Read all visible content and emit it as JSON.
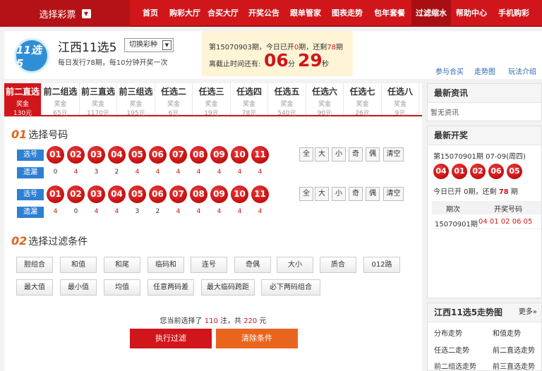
{
  "nav": {
    "select_label": "选择彩票",
    "items": [
      "首页",
      "购彩大厅",
      "合买大厅",
      "开奖公告",
      "跟单管家",
      "图表走势",
      "包年套餐",
      "过滤缩水",
      "帮助中心",
      "手机购彩"
    ],
    "active_index": 7
  },
  "lottery": {
    "logo_text": "11选5",
    "name": "江西11选5",
    "switch_label": "切换彩种",
    "subtitle": "每日发行78期，每10分钟开奖一次"
  },
  "period": {
    "prefix": "第",
    "issue": "15070903",
    "suffix1": "期，今日已开",
    "opened": "0",
    "suffix2": "期，还剩",
    "remain": "78",
    "suffix3": "期",
    "deadline_label": "离截止时间还有:",
    "minutes": "06",
    "min_unit": "分",
    "seconds": "29",
    "sec_unit": "秒"
  },
  "head_links": [
    "参与合买",
    "走势图",
    "玩法介绍"
  ],
  "tabs": [
    {
      "name": "前二直选",
      "label": "奖金",
      "prize": "130元"
    },
    {
      "name": "前二组选",
      "label": "奖金",
      "prize": "65元"
    },
    {
      "name": "前三直选",
      "label": "奖金",
      "prize": "1170元"
    },
    {
      "name": "前三组选",
      "label": "奖金",
      "prize": "195元"
    },
    {
      "name": "任选二",
      "label": "奖金",
      "prize": "6元"
    },
    {
      "name": "任选三",
      "label": "奖金",
      "prize": "19元"
    },
    {
      "name": "任选四",
      "label": "奖金",
      "prize": "78元"
    },
    {
      "name": "任选五",
      "label": "奖金",
      "prize": "540元"
    },
    {
      "name": "任选六",
      "label": "奖金",
      "prize": "90元"
    },
    {
      "name": "任选七",
      "label": "奖金",
      "prize": "26元"
    },
    {
      "name": "任选八",
      "label": "奖金",
      "prize": "9元"
    }
  ],
  "pick": {
    "num_label": "01",
    "title": "选择号码",
    "pick_label": "选号",
    "miss_label": "遗漏",
    "balls": [
      "01",
      "02",
      "03",
      "04",
      "05",
      "06",
      "07",
      "08",
      "09",
      "10",
      "11"
    ],
    "rows": [
      {
        "miss": [
          "0",
          "4",
          "3",
          "2",
          "4",
          "4",
          "4",
          "4",
          "4",
          "4",
          "4"
        ]
      },
      {
        "miss": [
          "4",
          "0",
          "4",
          "4",
          "3",
          "2",
          "4",
          "4",
          "4",
          "4",
          "4"
        ]
      }
    ],
    "filters": [
      "全",
      "大",
      "小",
      "奇",
      "偶",
      "清空"
    ]
  },
  "filter": {
    "num_label": "02",
    "title": "选择过滤条件",
    "row1": [
      "胆组合",
      "和值",
      "和尾",
      "临码和",
      "连号",
      "奇偶",
      "大小",
      "质合",
      "012路"
    ],
    "row2": [
      "最大值",
      "最小值",
      "均值",
      "任意两码差",
      "最大临码跨距",
      "必下两码组合"
    ]
  },
  "selection": {
    "p1": "您当前选择了",
    "count": "110",
    "p2": "注，共",
    "amount": "220",
    "p3": "元"
  },
  "buttons": {
    "execute": "执行过滤",
    "clear": "清除条件"
  },
  "news": {
    "title": "最新资讯",
    "empty": "暂无资讯"
  },
  "latest": {
    "title": "最新开奖",
    "issue_line": "第15070901期 07-09(周四)",
    "balls": [
      "04",
      "01",
      "02",
      "06",
      "05"
    ],
    "status": "今日已开 0期，还剩 ",
    "remain": "78",
    "status_end": " 期",
    "col1": "期次",
    "col2": "开奖号码",
    "row_issue": "15070901期",
    "row_nums": "04 01 02 06 05"
  },
  "trend": {
    "title": "江西11选5走势图",
    "more": "更多»",
    "links": [
      "分布走势",
      "和值走势",
      "任选二走势",
      "前二直选走势",
      "前二组选走势",
      "前三直选走势"
    ]
  },
  "colors": {
    "brand_red": "#d0161b",
    "tab_active": "#d0161b",
    "label_blue": "#2f7fd3",
    "orange": "#e9651e"
  }
}
